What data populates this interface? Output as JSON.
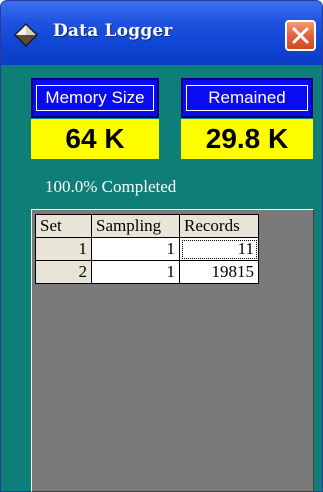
{
  "window": {
    "title": "Data Logger"
  },
  "memory": {
    "label": "Memory Size",
    "value": "64 K"
  },
  "remained": {
    "label": "Remained",
    "value": "29.8 K"
  },
  "status": {
    "text": "100.0% Completed"
  },
  "table": {
    "columns": [
      "Set",
      "Sampling",
      "Records"
    ],
    "rows": [
      {
        "set": "1",
        "sampling": "1",
        "records": "11"
      },
      {
        "set": "2",
        "sampling": "1",
        "records": "19815"
      }
    ]
  },
  "colors": {
    "titlebar": "#1d52de",
    "body": "#0e7e78",
    "label_bg": "#0b0bf2",
    "value_bg": "#ffff00",
    "close": "#e25f34",
    "grid_bg": "#7a7a7a"
  },
  "icons": {
    "app": "diamond-icon",
    "close": "close-icon"
  }
}
